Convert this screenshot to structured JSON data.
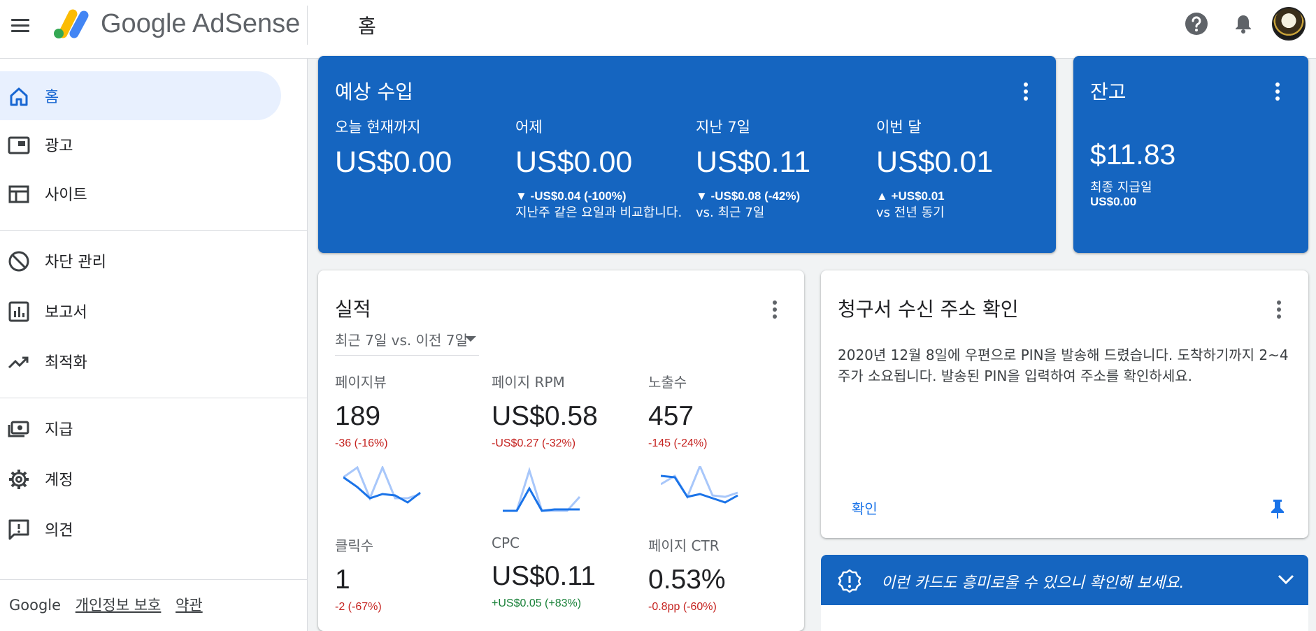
{
  "app": {
    "brand": "Google AdSense",
    "page_title": "홈"
  },
  "sidebar": {
    "items": [
      {
        "label": "홈",
        "icon": "home-icon",
        "active": true
      },
      {
        "label": "광고",
        "icon": "ads-icon"
      },
      {
        "label": "사이트",
        "icon": "sites-icon"
      },
      {
        "label": "차단 관리",
        "icon": "block-icon"
      },
      {
        "label": "보고서",
        "icon": "reports-icon"
      },
      {
        "label": "최적화",
        "icon": "trending-up-icon"
      },
      {
        "label": "지급",
        "icon": "payments-icon"
      },
      {
        "label": "계정",
        "icon": "gear-icon"
      },
      {
        "label": "의견",
        "icon": "feedback-icon"
      }
    ],
    "footer": {
      "google": "Google",
      "privacy": "개인정보 보호",
      "terms": "약관"
    }
  },
  "estimated": {
    "title": "예상 수입",
    "columns": [
      {
        "label": "오늘 현재까지",
        "value": "US$0.00",
        "delta": "",
        "note": ""
      },
      {
        "label": "어제",
        "value": "US$0.00",
        "delta": "▼ -US$0.04 (-100%)",
        "note": "지난주 같은 요일과 비교합니다."
      },
      {
        "label": "지난 7일",
        "value": "US$0.11",
        "delta": "▼ -US$0.08 (-42%)",
        "note": "vs. 최근 7일"
      },
      {
        "label": "이번 달",
        "value": "US$0.01",
        "delta": "▲ +US$0.01",
        "note": "vs 전년 동기"
      }
    ]
  },
  "balance": {
    "title": "잔고",
    "value": "$11.83",
    "label": "최종 지급일",
    "amount": "US$0.00"
  },
  "performance": {
    "title": "실적",
    "range": "최근 7일 vs. 이전 7일",
    "metrics": [
      {
        "label": "페이지뷰",
        "value": "189",
        "delta": "-36 (-16%)",
        "trend": "negative"
      },
      {
        "label": "페이지 RPM",
        "value": "US$0.58",
        "delta": "-US$0.27 (-32%)",
        "trend": "negative"
      },
      {
        "label": "노출수",
        "value": "457",
        "delta": "-145 (-24%)",
        "trend": "negative"
      },
      {
        "label": "클릭수",
        "value": "1",
        "delta": "-2 (-67%)",
        "trend": "negative"
      },
      {
        "label": "CPC",
        "value": "US$0.11",
        "delta": "+US$0.05 (+83%)",
        "trend": "positive"
      },
      {
        "label": "페이지 CTR",
        "value": "0.53%",
        "delta": "-0.8pp (-60%)",
        "trend": "negative"
      }
    ]
  },
  "billing": {
    "title": "청구서 수신 주소 확인",
    "text": "2020년 12월 8일에 우편으로 PIN을 발송해 드렸습니다. 도착하기까지 2~4주가 소요됩니다. 발송된 PIN을 입력하여 주소를 확인하세요.",
    "confirm": "확인"
  },
  "banner": {
    "text": "이런 카드도 흥미로울 수 있으니 확인해 보세요."
  },
  "colors": {
    "accent": "#1565c0",
    "negative": "#c5221f",
    "positive": "#188038",
    "link": "#1a73e8"
  }
}
